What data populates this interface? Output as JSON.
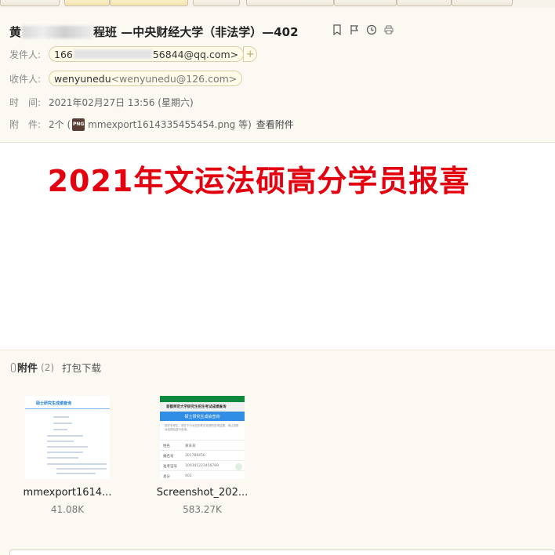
{
  "email": {
    "subject_prefix": "黄",
    "subject_suffix": "程班 —中央财经大学（非法学）—402",
    "sender_label": "发件人:",
    "sender_start": "166",
    "sender_end": "56844@qq.com>",
    "add_contact": "+",
    "recipient_label": "收件人:",
    "recipient_name": "wenyunedu",
    "recipient_email": "<wenyunedu@126.com>",
    "time_label": "时　间:",
    "time_value": "2021年02月27日 13:56 (星期六)",
    "attach_label": "附　件:",
    "attach_count_text": "2个 (",
    "attach_file": "mmexport1614335455454.png 等)",
    "view_attachments": "查看附件",
    "file_icon_text": "PNG"
  },
  "body": {
    "headline": "2021年文运法硕高分学员报喜"
  },
  "attachments": {
    "title": "附件",
    "count": "(2)",
    "download_all": "打包下载",
    "items": [
      {
        "name": "mmexport1614...",
        "size": "41.08K"
      },
      {
        "name": "Screenshot_202...",
        "size": "583.27K"
      }
    ],
    "doc_thumb_title": "硕士研究生成绩查询",
    "phone_thumb": {
      "header": "首都师范大学研究生招生考试成绩查询",
      "button": "硕士研究生成绩查询",
      "note": "您好本考生，请在下方对应的考试成绩的查询结果，请认真核对成绩后进行查询。",
      "rows": [
        {
          "k": "姓名",
          "v": "黄某某"
        },
        {
          "k": "报名号",
          "v": "301789456"
        },
        {
          "k": "准考证号",
          "v": "100341223456789"
        },
        {
          "k": "总分",
          "v": "402"
        }
      ]
    }
  },
  "colors": {
    "headline": "#e3000f",
    "header_bg": "#fcf9f3",
    "phone_green": "#0e8a3e",
    "phone_blue": "#2f8de4"
  }
}
